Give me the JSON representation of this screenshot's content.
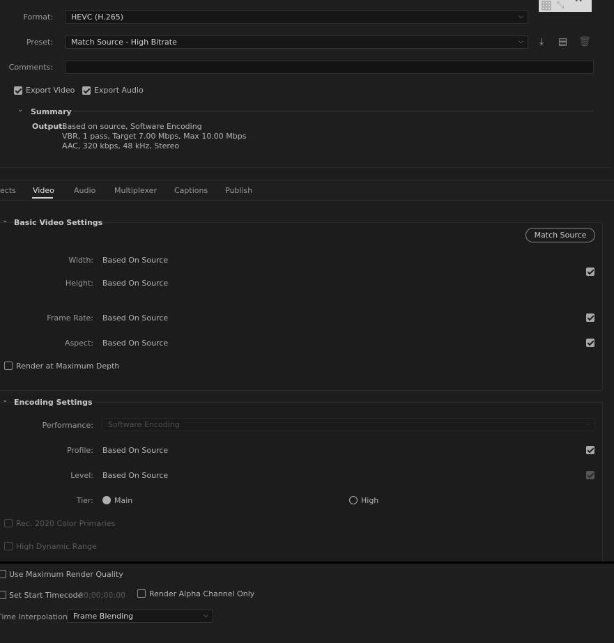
{
  "format": {
    "label": "Format:",
    "value": "HEVC (H.265)"
  },
  "preset": {
    "label": "Preset:",
    "value": "Match Source - High Bitrate"
  },
  "comments": {
    "label": "Comments:",
    "value": ""
  },
  "export_video": "Export Video",
  "export_audio": "Export Audio",
  "summary": {
    "title": "Summary",
    "output_label": "Output:",
    "lines": [
      "Based on source, Software Encoding",
      "VBR, 1 pass, Target 7.00 Mbps, Max 10.00 Mbps",
      "AAC, 320 kbps, 48 kHz, Stereo"
    ]
  },
  "tabs": [
    "ects",
    "Video",
    "Audio",
    "Multiplexer",
    "Captions",
    "Publish"
  ],
  "basic_video": {
    "title": "Basic Video Settings",
    "match_source": "Match Source",
    "width_label": "Width:",
    "width_value": "Based On Source",
    "height_label": "Height:",
    "height_value": "Based On Source",
    "frame_rate_label": "Frame Rate:",
    "frame_rate_value": "Based On Source",
    "aspect_label": "Aspect:",
    "aspect_value": "Based On Source",
    "render_max_depth": "Render at Maximum Depth"
  },
  "encoding": {
    "title": "Encoding Settings",
    "performance_label": "Performance:",
    "performance_value": "Software Encoding",
    "profile_label": "Profile:",
    "profile_value": "Based On Source",
    "level_label": "Level:",
    "level_value": "Based On Source",
    "tier_label": "Tier:",
    "tier_main": "Main",
    "tier_high": "High",
    "rec2020": "Rec. 2020 Color Primaries",
    "hdr": "High Dynamic Range"
  },
  "bottom": {
    "max_render_quality": "Use Maximum Render Quality",
    "set_start_timecode": "Set Start Timecode",
    "timecode_value": "00;00;00;00",
    "render_alpha": "Render Alpha Channel Only",
    "time_interp_label": "Time Interpolation:",
    "time_interp_value": "Frame Blending"
  },
  "icons": [
    "save-preset-icon",
    "import-preset-icon",
    "delete-preset-icon",
    "chevron-down-icon",
    "checkbox-icon"
  ]
}
